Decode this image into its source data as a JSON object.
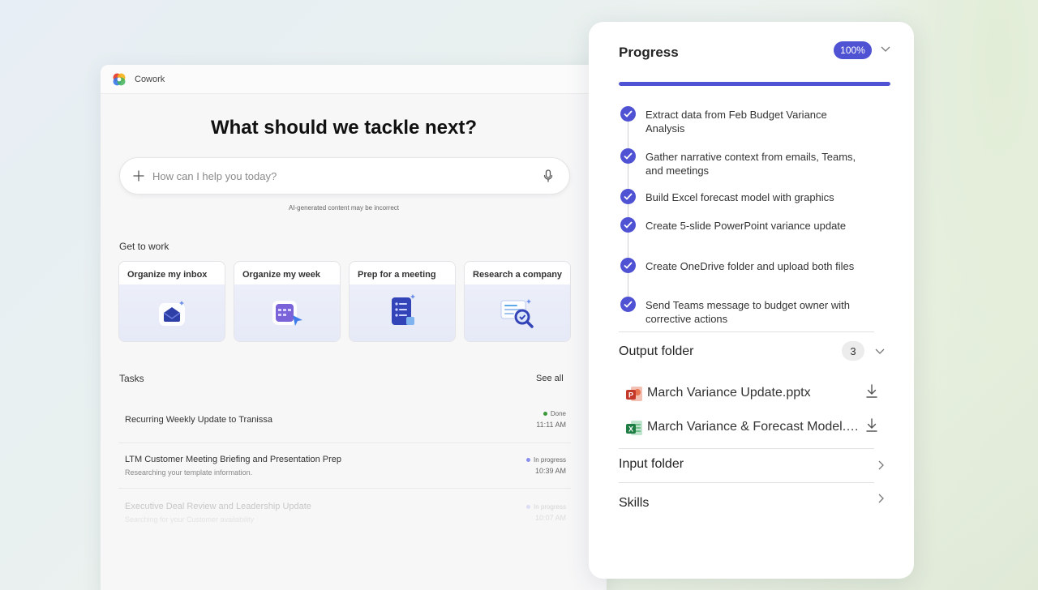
{
  "app": {
    "title": "Cowork"
  },
  "home": {
    "headline": "What should we tackle next?",
    "search_placeholder": "How can I help you today?",
    "disclaimer": "AI-generated content may be incorrect",
    "get_to_work_label": "Get to work",
    "cards": [
      {
        "label": "Organize my inbox",
        "icon": "inbox-icon"
      },
      {
        "label": "Organize my week",
        "icon": "calendar-icon"
      },
      {
        "label": "Prep for a meeting",
        "icon": "checklist-icon"
      },
      {
        "label": "Research a company",
        "icon": "research-icon"
      }
    ]
  },
  "tasks": {
    "label": "Tasks",
    "see_all": "See all",
    "items": [
      {
        "title": "Recurring Weekly Update to Tranissa",
        "subtitle": "",
        "status": "Done",
        "status_color": "#3a9a3a",
        "time": "11:11 AM"
      },
      {
        "title": "LTM Customer Meeting Briefing and Presentation Prep",
        "subtitle": "Researching your template information.",
        "status": "In progress",
        "status_color": "#8a8ff0",
        "time": "10:39 AM"
      },
      {
        "title": "Executive Deal Review and Leadership Update",
        "subtitle": "Searching for your Customer availability",
        "status": "In progress",
        "status_color": "#8a8ff0",
        "time": "10:07 AM"
      }
    ]
  },
  "progress": {
    "title": "Progress",
    "percent_label": "100%",
    "percent": 100,
    "accent_color": "#4f52d3",
    "steps": [
      "Extract data from Feb Budget Variance Analysis",
      "Gather narrative context from emails, Teams, and meetings",
      "Build Excel forecast model with graphics",
      "Create 5-slide PowerPoint variance update",
      "Create OneDrive folder and upload both files",
      "Send Teams message to budget owner with corrective actions"
    ]
  },
  "output_folder": {
    "title": "Output folder",
    "count": "3",
    "files": [
      {
        "name": "March Variance Update.pptx",
        "icon": "powerpoint-icon"
      },
      {
        "name": "March Variance & Forecast Model.xlsx",
        "icon": "excel-icon"
      }
    ]
  },
  "input_folder": {
    "title": "Input folder"
  },
  "skills": {
    "title": "Skills"
  }
}
